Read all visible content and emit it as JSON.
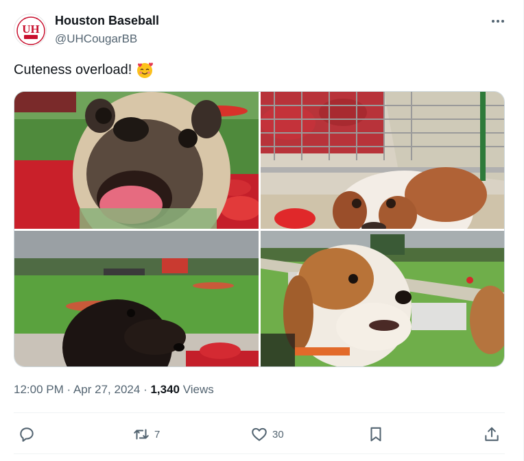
{
  "account": {
    "display_name": "Houston Baseball",
    "handle": "@UHCougarBB",
    "avatar_text": "UH"
  },
  "tweet": {
    "text": "Cuteness overload!",
    "emoji": "smiling-face-with-hearts-emoji"
  },
  "media": {
    "photos": [
      {
        "subject": "pug"
      },
      {
        "subject": "basset-hound"
      },
      {
        "subject": "dachshund"
      },
      {
        "subject": "beagle"
      }
    ]
  },
  "meta": {
    "time": "12:00 PM",
    "sep1": "·",
    "date": "Apr 27, 2024",
    "sep2": "·",
    "views_count": "1,340",
    "views_label": "Views"
  },
  "actions": {
    "reply_count": "",
    "retweet_count": "7",
    "like_count": "30"
  },
  "colors": {
    "brand_red": "#c8102e",
    "text_primary": "#0f1419",
    "text_secondary": "#536471",
    "border": "#cfd9de"
  }
}
